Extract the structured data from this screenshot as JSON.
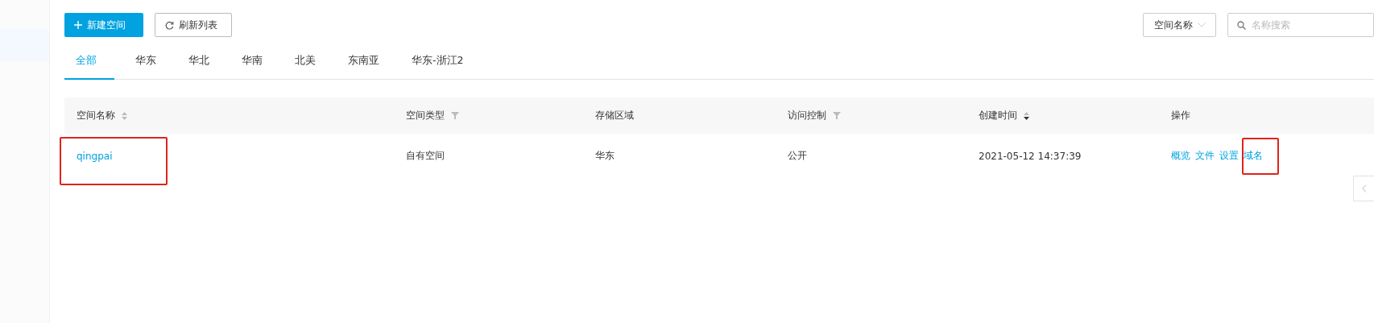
{
  "toolbar": {
    "create_button": "新建空间",
    "refresh_button": "刷新列表",
    "filter_dropdown": "空间名称",
    "search": {
      "placeholder": "名称搜索"
    }
  },
  "tabs": [
    {
      "label": "全部",
      "selected": true
    },
    {
      "label": "华东",
      "selected": false
    },
    {
      "label": "华北",
      "selected": false
    },
    {
      "label": "华南",
      "selected": false
    },
    {
      "label": "北美",
      "selected": false
    },
    {
      "label": "东南亚",
      "selected": false
    },
    {
      "label": "华东-浙江2",
      "selected": false
    }
  ],
  "table": {
    "columns": [
      {
        "label": "空间名称",
        "kind": "sort",
        "descending": false
      },
      {
        "label": "空间类型",
        "kind": "filter"
      },
      {
        "label": "存储区域",
        "kind": "plain"
      },
      {
        "label": "访问控制",
        "kind": "filter"
      },
      {
        "label": "创建时间",
        "kind": "sort",
        "descending": true
      },
      {
        "label": "操作",
        "kind": "plain"
      }
    ],
    "rows": [
      {
        "name": "qingpai",
        "name_highlighted": true,
        "type": "自有空间",
        "region": "华东",
        "access": "公开",
        "created": "2021-05-12 14:37:39",
        "actions": [
          {
            "label": "概览",
            "highlighted": false
          },
          {
            "label": "文件",
            "highlighted": false
          },
          {
            "label": "设置",
            "highlighted": false
          },
          {
            "label": "域名",
            "highlighted": true
          }
        ]
      }
    ]
  }
}
